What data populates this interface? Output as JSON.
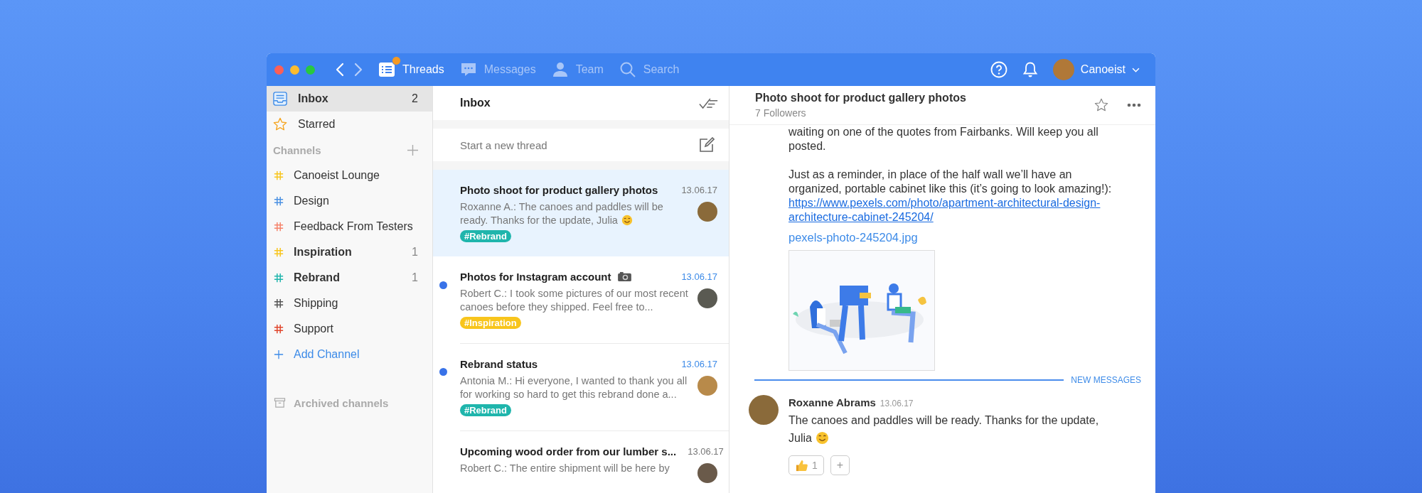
{
  "toolbar": {
    "tabs": [
      {
        "kind": "threads",
        "label": "Threads",
        "selected": true,
        "badge": true
      },
      {
        "kind": "messages",
        "label": "Messages",
        "selected": false,
        "badge": false
      },
      {
        "kind": "team",
        "label": "Team",
        "selected": false,
        "badge": false
      },
      {
        "kind": "search",
        "label": "Search",
        "selected": false,
        "badge": false
      }
    ],
    "user": {
      "name": "Canoeist"
    }
  },
  "sidebar": {
    "items": [
      {
        "kind": "inbox",
        "label": "Inbox",
        "count": "2",
        "selected": true
      },
      {
        "kind": "starred",
        "label": "Starred",
        "selected": false
      }
    ],
    "channels_heading": "Channels",
    "channels": [
      {
        "name": "Canoeist Lounge",
        "color": "#f8c51c",
        "unread": false
      },
      {
        "name": "Design",
        "color": "#4a90e2",
        "unread": false
      },
      {
        "name": "Feedback From Testers",
        "color": "#f5826a",
        "unread": false
      },
      {
        "name": "Inspiration",
        "color": "#f8c51c",
        "unread": true,
        "count": "1"
      },
      {
        "name": "Rebrand",
        "color": "#1fb5ac",
        "unread": true,
        "count": "1"
      },
      {
        "name": "Shipping",
        "color": "#555555",
        "unread": false
      },
      {
        "name": "Support",
        "color": "#e0452b",
        "unread": false
      }
    ],
    "add_channel": "Add Channel",
    "archived": "Archived channels"
  },
  "threads": {
    "title": "Inbox",
    "compose_placeholder": "Start a new thread",
    "items": [
      {
        "title": "Photo shoot for product gallery photos",
        "title_icon": false,
        "date": "13.06.17",
        "preview": "Roxanne A.: The canoes and paddles will be ready. Thanks for the update, Julia",
        "smiley": true,
        "tag": {
          "label": "#Rebrand",
          "color": "#1fb5ac"
        },
        "unread": false,
        "selected": true
      },
      {
        "title": "Photos for Instagram account",
        "title_icon": true,
        "date": "13.06.17",
        "preview": "Robert C.: I took some pictures of our most recent canoes before they shipped. Feel free to...",
        "smiley": false,
        "tag": {
          "label": "#Inspiration",
          "color": "#f8c51c"
        },
        "unread": true,
        "selected": false
      },
      {
        "title": "Rebrand status",
        "title_icon": false,
        "date": "13.06.17",
        "preview": "Antonia M.: Hi everyone,  I wanted to thank you all for working so hard to get this rebrand done a...",
        "smiley": false,
        "tag": {
          "label": "#Rebrand",
          "color": "#1fb5ac"
        },
        "unread": true,
        "selected": false
      },
      {
        "title": "Upcoming wood order from our lumber s...",
        "title_icon": false,
        "date": "13.06.17",
        "preview": "Robert C.: The entire shipment will be here by",
        "smiley": false,
        "unread": false,
        "selected": false
      }
    ]
  },
  "conversation": {
    "title": "Photo shoot for product gallery photos",
    "followers": "7 Followers",
    "paragraphs": [
      "waiting on one of the quotes from Fairbanks. Will keep you all posted.",
      "Just as a reminder, in place of the half wall we’ll have an organized, portable cabinet like this (it’s going to look amazing!):"
    ],
    "link": "https://www.pexels.com/photo/apartment-architectural-design-architecture-cabinet-245204/",
    "attachment": "pexels-photo-245204.jpg",
    "divider": "NEW MESSAGES",
    "message": {
      "author": "Roxanne Abrams",
      "date": "13.06.17",
      "text": "The canoes and paddles will be ready. Thanks for the update, Julia",
      "smiley": true,
      "reactions": [
        {
          "count": "1"
        }
      ],
      "add_reaction": "+"
    }
  }
}
